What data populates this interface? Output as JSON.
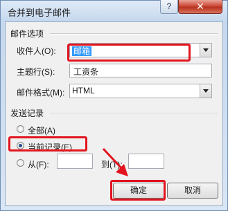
{
  "window": {
    "title": "合并到电子邮件",
    "help_label": "?",
    "close_label": "✕"
  },
  "mail_options": {
    "group_label": "邮件选项",
    "recipient_label": "收件人(O):",
    "recipient_value": "邮箱",
    "subject_label": "主题行(S):",
    "subject_value": "工资条",
    "format_label": "邮件格式(M):",
    "format_value": "HTML"
  },
  "send_records": {
    "group_label": "发送记录",
    "all_label": "全部(A)",
    "current_label": "当前记录(E)",
    "from_label": "从(F):",
    "to_label": "到(T):",
    "selected": "current"
  },
  "buttons": {
    "ok_label": "确定",
    "cancel_label": "取消"
  },
  "colors": {
    "highlight": "#e2141e",
    "selection": "#3399ff",
    "close_button": "#c7412d"
  }
}
